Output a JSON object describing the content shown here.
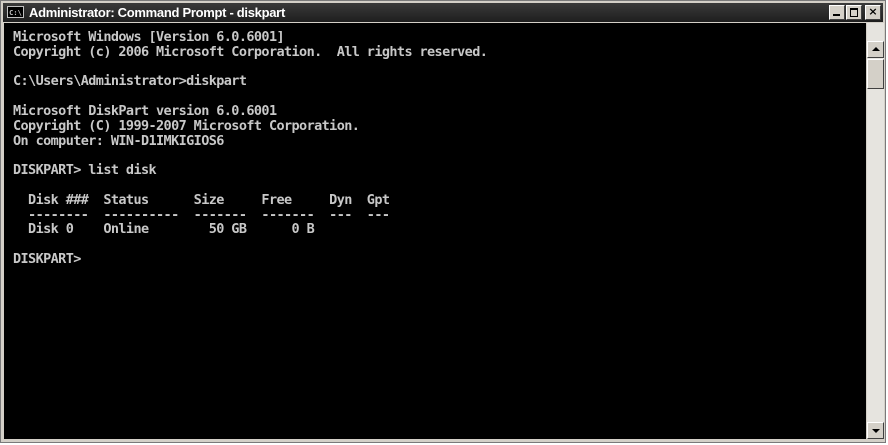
{
  "window": {
    "title": "Administrator: Command Prompt - diskpart",
    "icon_label": "C:\\",
    "icon": "console-icon",
    "controls": {
      "minimize": "minimize-icon",
      "maximize": "maximize-icon",
      "close": "×"
    }
  },
  "console": {
    "lines": [
      "Microsoft Windows [Version 6.0.6001]",
      "Copyright (c) 2006 Microsoft Corporation.  All rights reserved.",
      "",
      "C:\\Users\\Administrator>diskpart",
      "",
      "Microsoft DiskPart version 6.0.6001",
      "Copyright (C) 1999-2007 Microsoft Corporation.",
      "On computer: WIN-D1IMKIGIOS6",
      "",
      "DISKPART> list disk",
      "",
      "  Disk ###  Status      Size     Free     Dyn  Gpt",
      "  --------  ----------  -------  -------  ---  ---",
      "  Disk 0    Online        50 GB      0 B",
      "",
      "DISKPART> "
    ]
  },
  "colors": {
    "console_bg": "#000000",
    "console_fg": "#c8c8c8",
    "titlebar": "#2a2a2a",
    "frame": "#d4d0c8"
  }
}
